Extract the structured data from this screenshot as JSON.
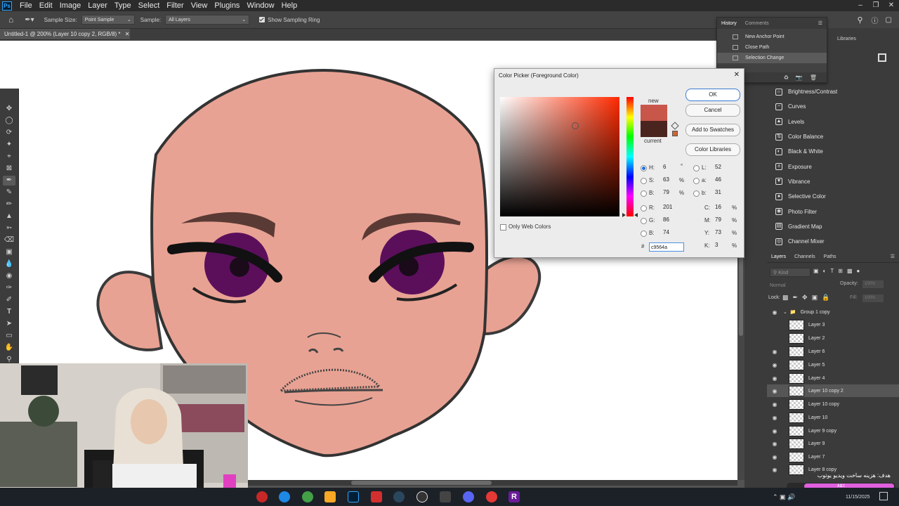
{
  "menubar": {
    "logo": "Ps",
    "items": [
      "File",
      "Edit",
      "Image",
      "Layer",
      "Type",
      "Select",
      "Filter",
      "View",
      "Plugins",
      "Window",
      "Help"
    ]
  },
  "options": {
    "sample_size_label": "Sample Size:",
    "sample_size_value": "Point Sample",
    "sample_label": "Sample:",
    "sample_value": "All Layers",
    "show_ring_label": "Show Sampling Ring",
    "show_ring_checked": true
  },
  "document": {
    "tab_title": "Untitled-1 @ 200% (Layer 10 copy 2, RGB/8) *"
  },
  "history": {
    "tab_history": "History",
    "tab_comments": "Comments",
    "items": [
      "New Anchor Point",
      "Close Path",
      "Selection Change"
    ],
    "selected": "Selection Change"
  },
  "libraries": {
    "label": "Libraries"
  },
  "adjustments": [
    {
      "label": "Brightness/Contrast",
      "icon": "brightness-icon"
    },
    {
      "label": "Curves",
      "icon": "curves-icon"
    },
    {
      "label": "Levels",
      "icon": "levels-icon"
    },
    {
      "label": "Color Balance",
      "icon": "color-balance-icon"
    },
    {
      "label": "Black & White",
      "icon": "black-white-icon"
    },
    {
      "label": "Exposure",
      "icon": "exposure-icon"
    },
    {
      "label": "Vibrance",
      "icon": "vibrance-icon"
    },
    {
      "label": "Selective Color",
      "icon": "selective-color-icon"
    },
    {
      "label": "Photo Filter",
      "icon": "photo-filter-icon"
    },
    {
      "label": "Gradient Map",
      "icon": "gradient-map-icon"
    },
    {
      "label": "Channel Mixer",
      "icon": "channel-mixer-icon"
    }
  ],
  "layers_panel": {
    "tabs": [
      "Layers",
      "Channels",
      "Paths"
    ],
    "kind_placeholder": "Kind",
    "blend_mode": "Normal",
    "opacity_label": "Opacity:",
    "opacity_value": "100%",
    "lock_label": "Lock:",
    "fill_label": "Fill:",
    "fill_value": "100%",
    "group_name": "Group 1 copy",
    "layers": [
      "Layer 3",
      "Layer 2",
      "Layer 6",
      "Layer 5",
      "Layer 4",
      "Layer 10 copy 2",
      "Layer 10 copy",
      "Layer 10",
      "Layer 9 copy",
      "Layer 9",
      "Layer 7",
      "Layer 8 copy"
    ],
    "selected_layer": "Layer 10 copy 2"
  },
  "color_picker": {
    "title": "Color Picker (Foreground Color)",
    "new_label": "new",
    "current_label": "current",
    "ok_label": "OK",
    "cancel_label": "Cancel",
    "add_swatches_label": "Add to Swatches",
    "color_libraries_label": "Color Libraries",
    "only_web_colors_label": "Only Web Colors",
    "new_color": "#c9564a",
    "current_color": "#4a2520",
    "H": "6",
    "H_unit": "°",
    "S": "63",
    "S_unit": "%",
    "B": "79",
    "B_unit": "%",
    "R": "201",
    "G": "86",
    "Bl": "74",
    "L": "52",
    "a": "46",
    "b": "31",
    "C": "16",
    "M": "79",
    "Y": "73",
    "K": "3",
    "pct": "%",
    "hex_hash": "#",
    "hex": "c9564a"
  },
  "overlay": {
    "goal_text": "هدف: هزینه ساخت ویدیو یوتوب",
    "progress_pct": "۸۵٪",
    "progress_value": 0.85
  },
  "taskbar": {
    "date": "11/15/2025"
  }
}
